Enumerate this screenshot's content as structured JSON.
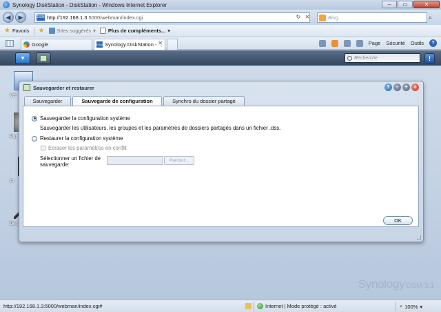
{
  "browser": {
    "title": "Synology DiskStation - DiskStation - Windows Internet Explorer",
    "url_host": "http://192.168.1.3",
    "url_path": ":5000/webman/index.cgi",
    "site_icon": "DSM",
    "search_placeholder": "Bing",
    "window_buttons": [
      "–",
      "▭",
      "✕"
    ],
    "nav_icons": [
      "back-icon",
      "forward-icon"
    ],
    "addr_buttons": [
      "↻",
      "✕"
    ]
  },
  "favorites_bar": {
    "favorites_label": "Favoris",
    "suggested_sites": "Sites suggérés",
    "more_addons": "Plus de compléments...",
    "dropdown_symbol": "▾"
  },
  "tabs": [
    {
      "label": "Google",
      "icon": "google-icon"
    },
    {
      "label": "Synology DiskStation - ...",
      "icon": "dsm-icon",
      "active": true
    }
  ],
  "toolbar": {
    "page": "Page",
    "security": "Sécurité",
    "tools": "Outils",
    "help_symbol": "?"
  },
  "dsm": {
    "search_placeholder": "Recherche",
    "notify_symbol": "!",
    "menu_symbol": "▾",
    "branding": "Synology",
    "branding_suffix": "DSM 3.1",
    "desktop_labels": [
      "Ver",
      "Par",
      "Ar",
      "Den"
    ]
  },
  "dialog": {
    "title": "Sauvegarder et restaurer",
    "tabs": [
      "Sauvegarder",
      "Sauvegarde de configuration",
      "Synchro du dossier partagé"
    ],
    "active_tab": 1,
    "option_backup": "Sauvegarder la configuration système",
    "backup_description": "Sauvegarder les utilisateurs, les groupes et les paramètres de dossiers partagés dans un fichier .dss.",
    "option_restore": "Restaurer la configuration système",
    "overwrite_conflict": "Ecraser les paramètres en conflit",
    "select_file_label": "Sélectionner un fichier de sauvegarde:",
    "browse_button": "Parcour...",
    "ok_button": "OK",
    "selected_option": "backup"
  },
  "statusbar": {
    "url": "http://192.168.1.3:5000/webman/index.cgi#",
    "zone": "Internet | Mode protégé : activé",
    "zoom": "100%"
  }
}
